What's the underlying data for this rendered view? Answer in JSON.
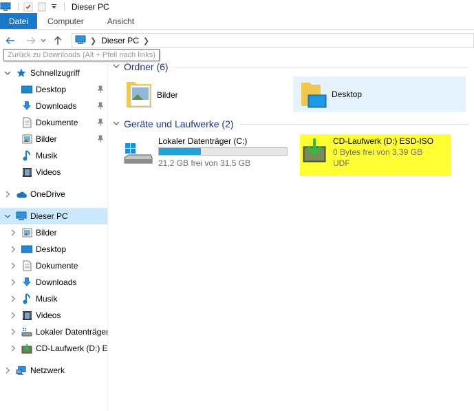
{
  "window": {
    "title": "Dieser PC"
  },
  "ribbon": {
    "tabs": [
      "Datei",
      "Computer",
      "Ansicht"
    ]
  },
  "address": {
    "path": [
      "Dieser PC"
    ]
  },
  "tooltip": {
    "text": "Zurück zu Downloads (Alt + Pfeil nach links)"
  },
  "sidebar": {
    "quick_access": {
      "label": "Schnellzugriff",
      "items": [
        {
          "label": "Desktop",
          "icon": "desktop-icon",
          "pinned": true
        },
        {
          "label": "Downloads",
          "icon": "download-icon",
          "pinned": true
        },
        {
          "label": "Dokumente",
          "icon": "document-icon",
          "pinned": true
        },
        {
          "label": "Bilder",
          "icon": "pictures-icon",
          "pinned": true
        },
        {
          "label": "Musik",
          "icon": "music-icon",
          "pinned": false
        },
        {
          "label": "Videos",
          "icon": "videos-icon",
          "pinned": false
        }
      ]
    },
    "onedrive": {
      "label": "OneDrive"
    },
    "this_pc": {
      "label": "Dieser PC",
      "items": [
        {
          "label": "Bilder",
          "icon": "pictures-icon"
        },
        {
          "label": "Desktop",
          "icon": "desktop-icon"
        },
        {
          "label": "Dokumente",
          "icon": "document-icon"
        },
        {
          "label": "Downloads",
          "icon": "download-icon"
        },
        {
          "label": "Musik",
          "icon": "music-icon"
        },
        {
          "label": "Videos",
          "icon": "videos-icon"
        },
        {
          "label": "Lokaler Datenträger (C:)",
          "icon": "hard-drive-icon"
        },
        {
          "label": "CD-Laufwerk (D:) ESD-ISO",
          "icon": "cd-drive-icon"
        }
      ]
    },
    "network": {
      "label": "Netzwerk"
    }
  },
  "content": {
    "folders": {
      "header": "Ordner (6)",
      "items": [
        {
          "label": "Bilder"
        },
        {
          "label": "Desktop"
        }
      ]
    },
    "drives": {
      "header": "Geräte und Laufwerke (2)",
      "items": [
        {
          "name": "Lokaler Datenträger (C:)",
          "free_text": "21,2 GB frei von 31,5 GB",
          "used_fraction": 0.327
        },
        {
          "name": "CD-Laufwerk (D:) ESD-ISO",
          "free_text": "0 Bytes frei von 3,39 GB",
          "filesystem": "UDF"
        }
      ]
    }
  },
  "colors": {
    "accent": "#1979ca",
    "selection": "#cce8ff",
    "highlight": "#ffff33",
    "group_title": "#1e3287",
    "progress": "#26a0da"
  }
}
